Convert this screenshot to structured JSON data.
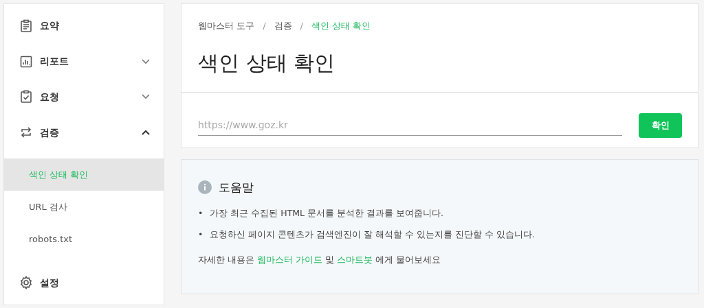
{
  "sidebar": {
    "items": [
      {
        "label": "요약"
      },
      {
        "label": "리포트",
        "expanded": false
      },
      {
        "label": "요청",
        "expanded": false
      },
      {
        "label": "검증",
        "expanded": true,
        "children": [
          {
            "label": "색인 상태 확인",
            "selected": true
          },
          {
            "label": "URL 검사",
            "selected": false
          },
          {
            "label": "robots.txt",
            "selected": false
          }
        ]
      },
      {
        "label": "설정"
      }
    ]
  },
  "breadcrumb": [
    {
      "kind": "link",
      "label": "웹마스터 도구",
      "selected": false
    },
    {
      "kind": "separator",
      "label": "/"
    },
    {
      "kind": "link",
      "label": "검증",
      "selected": false
    },
    {
      "kind": "separator",
      "label": "/"
    },
    {
      "kind": "link",
      "label": "색인 상태 확인",
      "selected": true
    }
  ],
  "page_title": "색인 상태 확인",
  "url_field": {
    "placeholder": "https://www.goz.kr"
  },
  "submit_button": "확인",
  "help": {
    "title": "도움말",
    "bullets": [
      {
        "marker": "•",
        "text": "가장 최근 수집된 HTML 문서를 분석한 결과를 보여줍니다."
      },
      {
        "marker": "•",
        "text": "요청하신 페이지 콘텐츠가 검색엔진이 잘 해석할 수 있는지를 진단할 수 있습니다."
      }
    ],
    "footer": [
      {
        "kind": "text",
        "text": "자세한 내용은 "
      },
      {
        "kind": "link",
        "text": "웹마스터 가이드"
      },
      {
        "kind": "text",
        "text": " 및 "
      },
      {
        "kind": "link",
        "text": "스마트봇"
      },
      {
        "kind": "text",
        "text": " 에게 물어보세요"
      }
    ]
  }
}
